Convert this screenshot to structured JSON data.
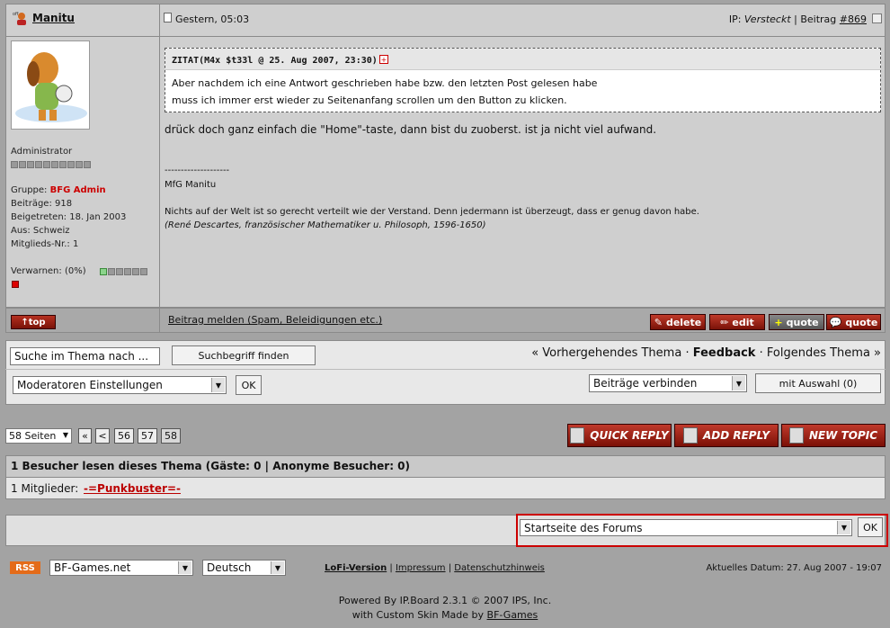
{
  "post": {
    "author": "Manitu",
    "date": "Gestern, 05:03",
    "ip_label": "IP:",
    "ip_value": "Versteckt",
    "post_label": "Beitrag",
    "post_number": "#869",
    "role": "Administrator",
    "group_label": "Gruppe:",
    "group_value": "BFG Admin",
    "posts_line": "Beiträge: 918",
    "joined_line": "Beigetreten: 18. Jan 2003",
    "from_line": "Aus: Schweiz",
    "member_no_line": "Mitglieds-Nr.: 1",
    "warn_label": "Verwarnen: (0%)",
    "quote_title": "ZITAT(M4x $t33l @ 25. Aug 2007, 23:30)",
    "quote_line1": "Aber nachdem ich eine Antwort geschrieben habe bzw. den letzten Post gelesen habe",
    "quote_line2": "muss ich immer erst wieder zu Seitenanfang scrollen um den Button zu klicken.",
    "text": "drück doch ganz einfach die \"Home\"-taste, dann bist du zuoberst. ist ja nicht viel aufwand.",
    "sig_sep": "--------------------",
    "sig_line1": "MfG Manitu",
    "sig_line2": "Nichts auf der Welt ist so gerecht verteilt wie der Verstand. Denn jedermann ist überzeugt, dass er genug davon habe.",
    "sig_line3": "(René Descartes, französischer Mathematiker u. Philosoph, 1596-1650)"
  },
  "post_footer": {
    "top": "top",
    "report": "Beitrag melden (Spam, Beleidigungen etc.)",
    "delete": "delete",
    "edit": "edit",
    "quote_plus": "quote",
    "quote": "quote"
  },
  "tools": {
    "search_value": "Suche im Thema nach ...",
    "search_btn": "Suchbegriff finden",
    "prev": "« Vorhergehendes Thema",
    "sep": "·",
    "feedback": "Feedback",
    "next": "Folgendes Thema »",
    "mod_select": "Moderatoren Einstellungen",
    "ok": "OK",
    "merge_select": "Beiträge verbinden",
    "with_selection": "mit Auswahl (0)"
  },
  "pagination": {
    "pages": "58 Seiten",
    "first": "«",
    "prev": "<",
    "p1": "56",
    "p2": "57",
    "p3": "58",
    "quick_reply": "QUICK REPLY",
    "add_reply": "ADD REPLY",
    "new_topic": "NEW TOPIC"
  },
  "visitors": {
    "header": "1 Besucher lesen dieses Thema (Gäste: 0 | Anonyme Besucher: 0)",
    "members_label": "1 Mitglieder:",
    "member": "-=Punkbuster=-"
  },
  "jump": {
    "select": "Startseite des Forums",
    "ok": "OK"
  },
  "footer": {
    "rss": "RSS",
    "skin_select": "BF-Games.net",
    "lang_select": "Deutsch",
    "lofi": "LoFi-Version",
    "impressum": "Impressum",
    "privacy": "Datenschutzhinweis",
    "date": "Aktuelles Datum: 27. Aug 2007 - 19:07",
    "powered": "Powered By IP.Board 2.3.1 © 2007  IPS, Inc.",
    "skin_by_prefix": "with Custom Skin Made by",
    "skin_by": "BF-Games"
  }
}
